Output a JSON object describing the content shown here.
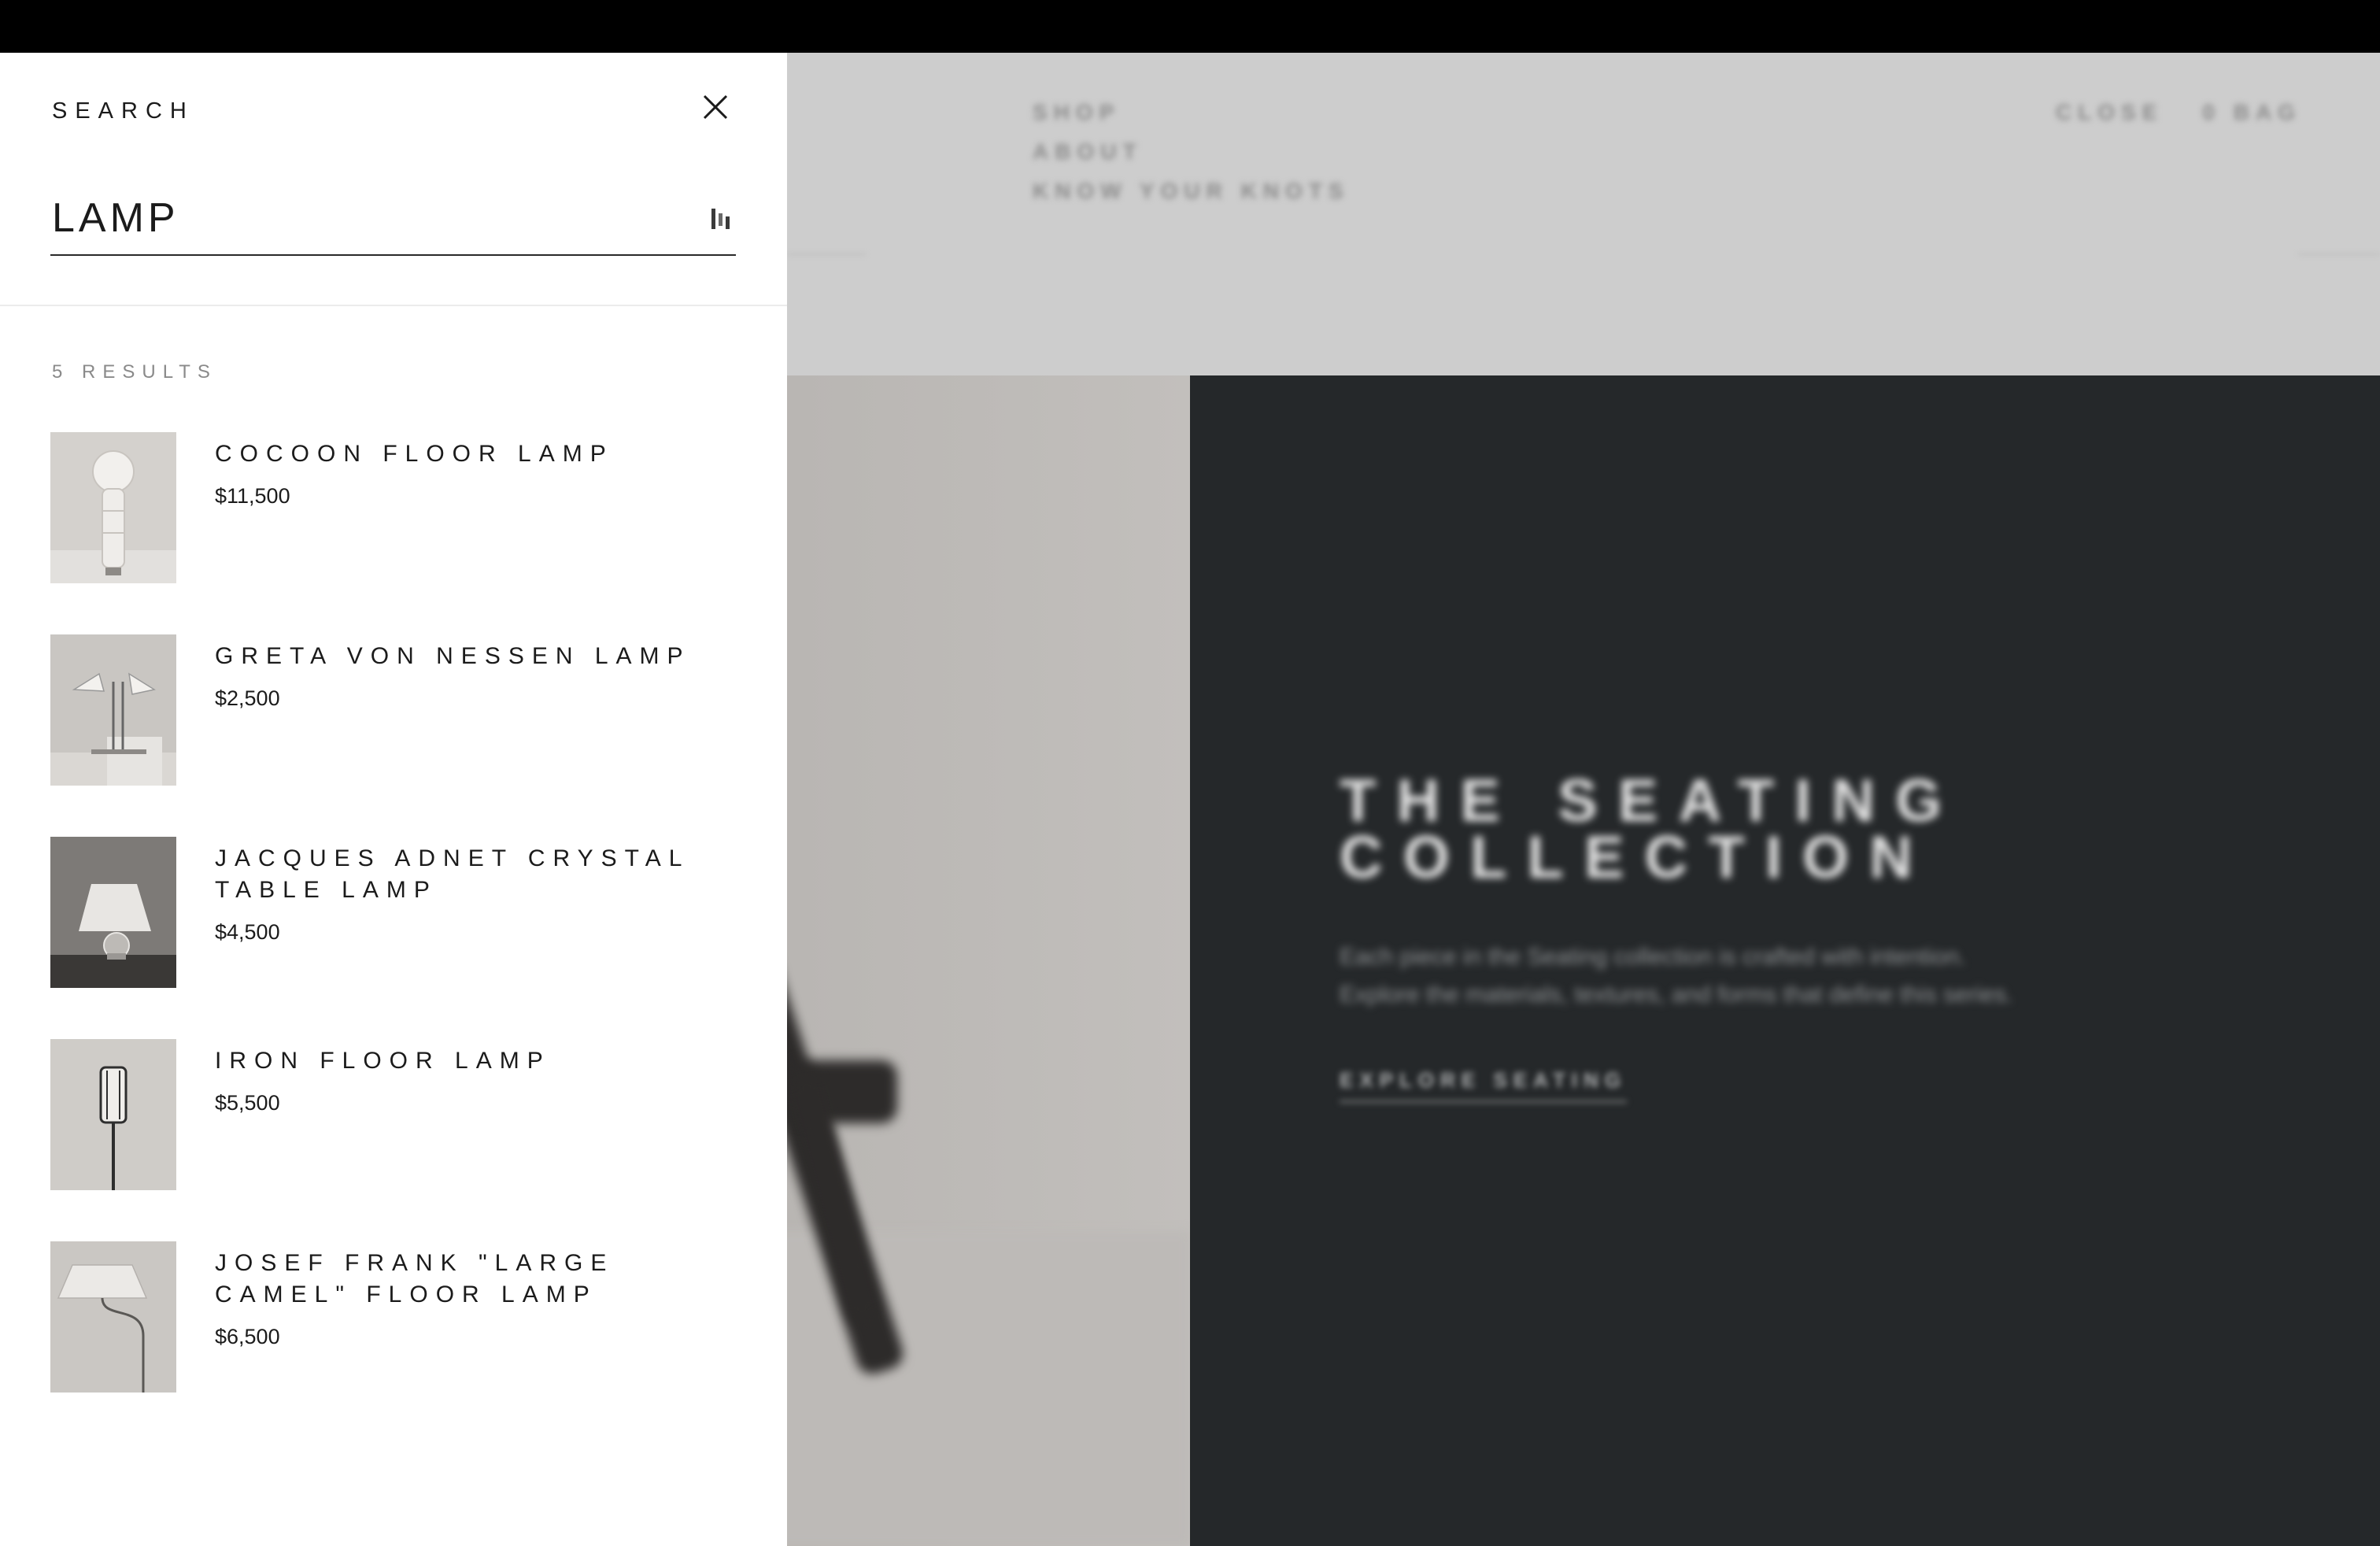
{
  "search_panel": {
    "title": "SEARCH",
    "query": "LAMP",
    "results_count": "5 RESULTS",
    "results": [
      {
        "name": "COCOON FLOOR LAMP",
        "price": "$11,500"
      },
      {
        "name": "GRETA VON NESSEN LAMP",
        "price": "$2,500"
      },
      {
        "name": "JACQUES ADNET CRYSTAL TABLE LAMP",
        "price": "$4,500"
      },
      {
        "name": "IRON FLOOR LAMP",
        "price": "$5,500"
      },
      {
        "name": "JOSEF FRANK \"LARGE CAMEL\" FLOOR LAMP",
        "price": "$6,500"
      }
    ]
  },
  "icons": {
    "close": "close-icon",
    "loading": "loading-spinner-icon"
  },
  "colors": {
    "panel_background": "#ffffff",
    "text_primary": "#1b1b1b",
    "text_muted": "#8a8a8a",
    "hero_dark": "#25282a"
  }
}
